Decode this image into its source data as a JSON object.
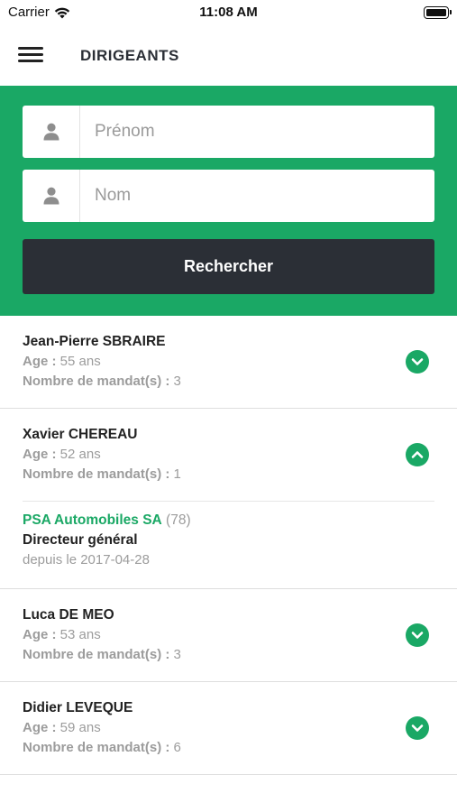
{
  "status_bar": {
    "carrier": "Carrier",
    "time": "11:08 AM"
  },
  "navbar": {
    "title": "DIRIGEANTS"
  },
  "search": {
    "first_name_placeholder": "Prénom",
    "first_name_value": "",
    "last_name_placeholder": "Nom",
    "last_name_value": "",
    "button_label": "Rechercher"
  },
  "labels": {
    "age": "Age :",
    "mandates": "Nombre de mandat(s) :"
  },
  "executives": [
    {
      "name": "Jean-Pierre SBRAIRE",
      "age": "55 ans",
      "mandates": "3",
      "expanded": false
    },
    {
      "name": "Xavier CHEREAU",
      "age": "52 ans",
      "mandates": "1",
      "expanded": true,
      "mandate": {
        "company": "PSA Automobiles SA",
        "company_count": "(78)",
        "role": "Directeur général",
        "since": "depuis le 2017-04-28"
      }
    },
    {
      "name": "Luca DE MEO",
      "age": "53 ans",
      "mandates": "3",
      "expanded": false
    },
    {
      "name": "Didier LEVEQUE",
      "age": "59 ans",
      "mandates": "6",
      "expanded": false
    }
  ],
  "colors": {
    "accent": "#1aa865",
    "dark": "#2b2f36",
    "muted": "#9c9c9c"
  },
  "icons": {
    "menu": "hamburger-menu-icon",
    "person": "person-icon",
    "expand": "chevron-down-icon",
    "collapse": "chevron-up-icon"
  }
}
